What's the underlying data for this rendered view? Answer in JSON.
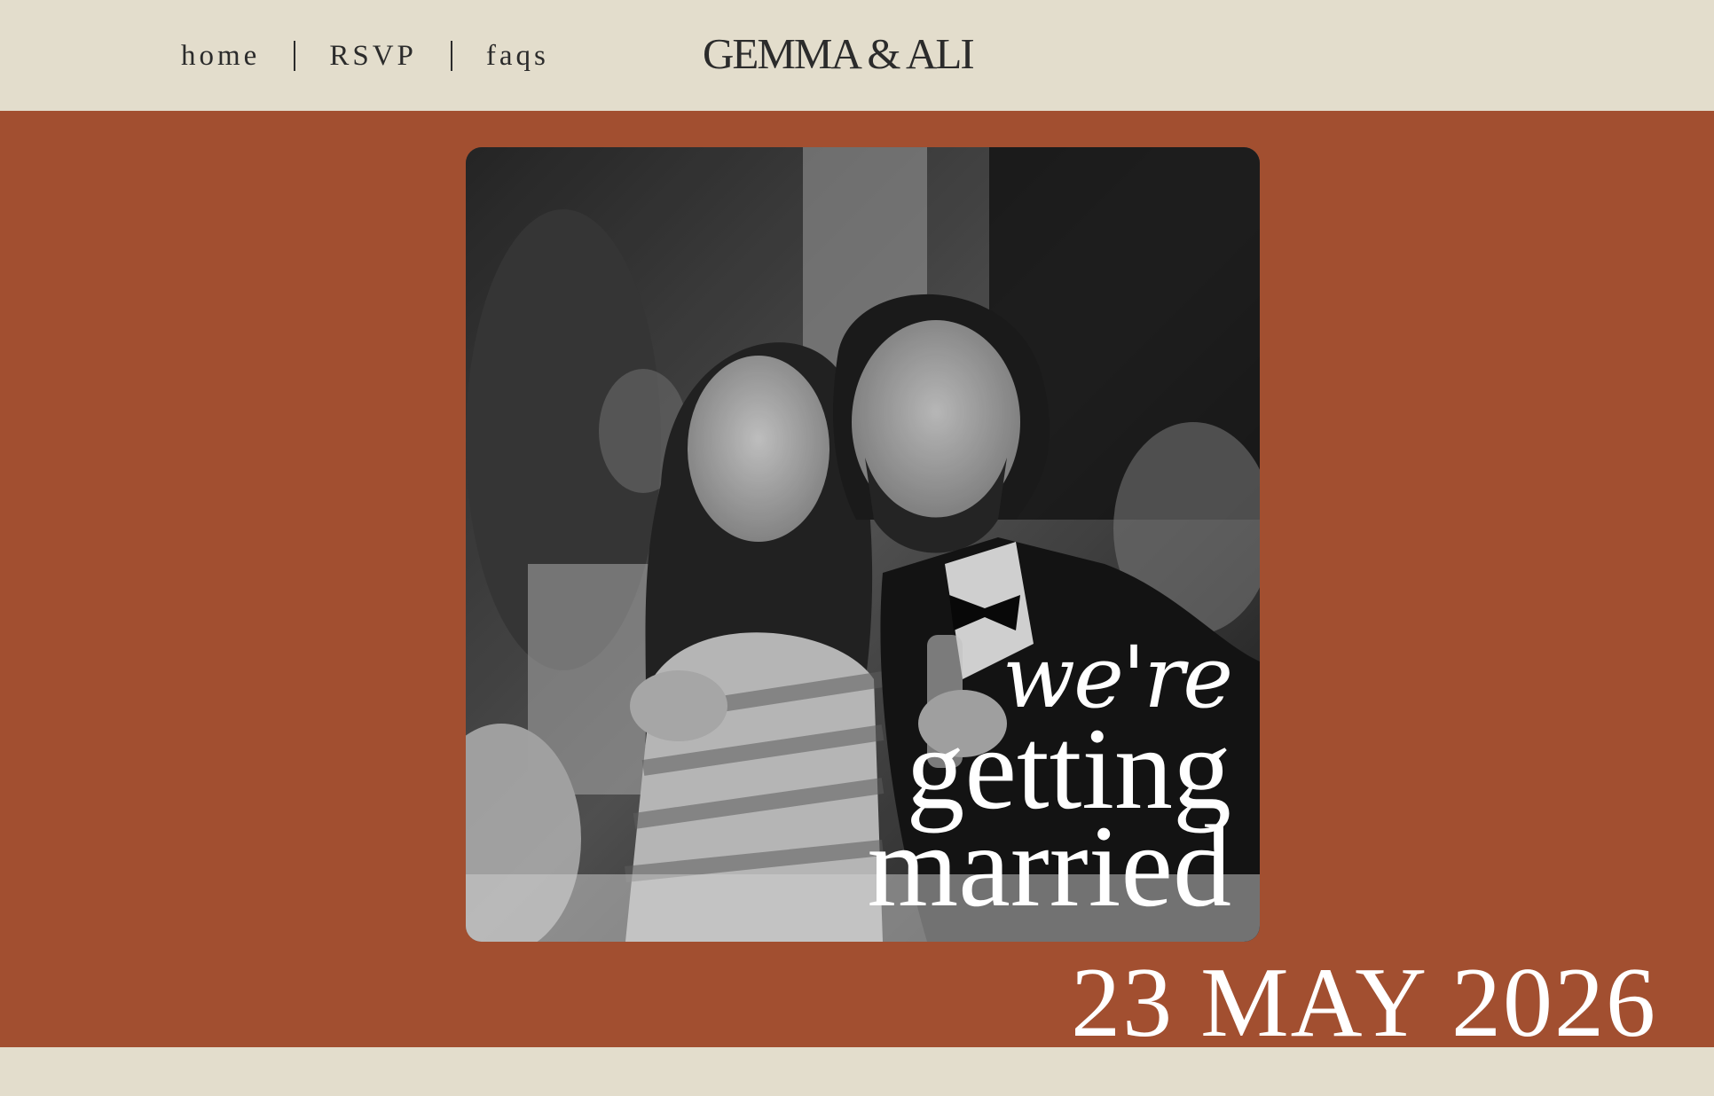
{
  "nav": {
    "home": "home",
    "rsvp": "RSVP",
    "faqs": "faqs"
  },
  "brand": {
    "title": "GEMMA & ALI"
  },
  "hero": {
    "line1": "we're",
    "line2": "getting",
    "line3": "married",
    "date": "23 MAY 2026"
  },
  "colors": {
    "background": "#e3ddcc",
    "hero": "#a24f30",
    "text": "#2b2b2b",
    "headline": "#ffffff"
  }
}
